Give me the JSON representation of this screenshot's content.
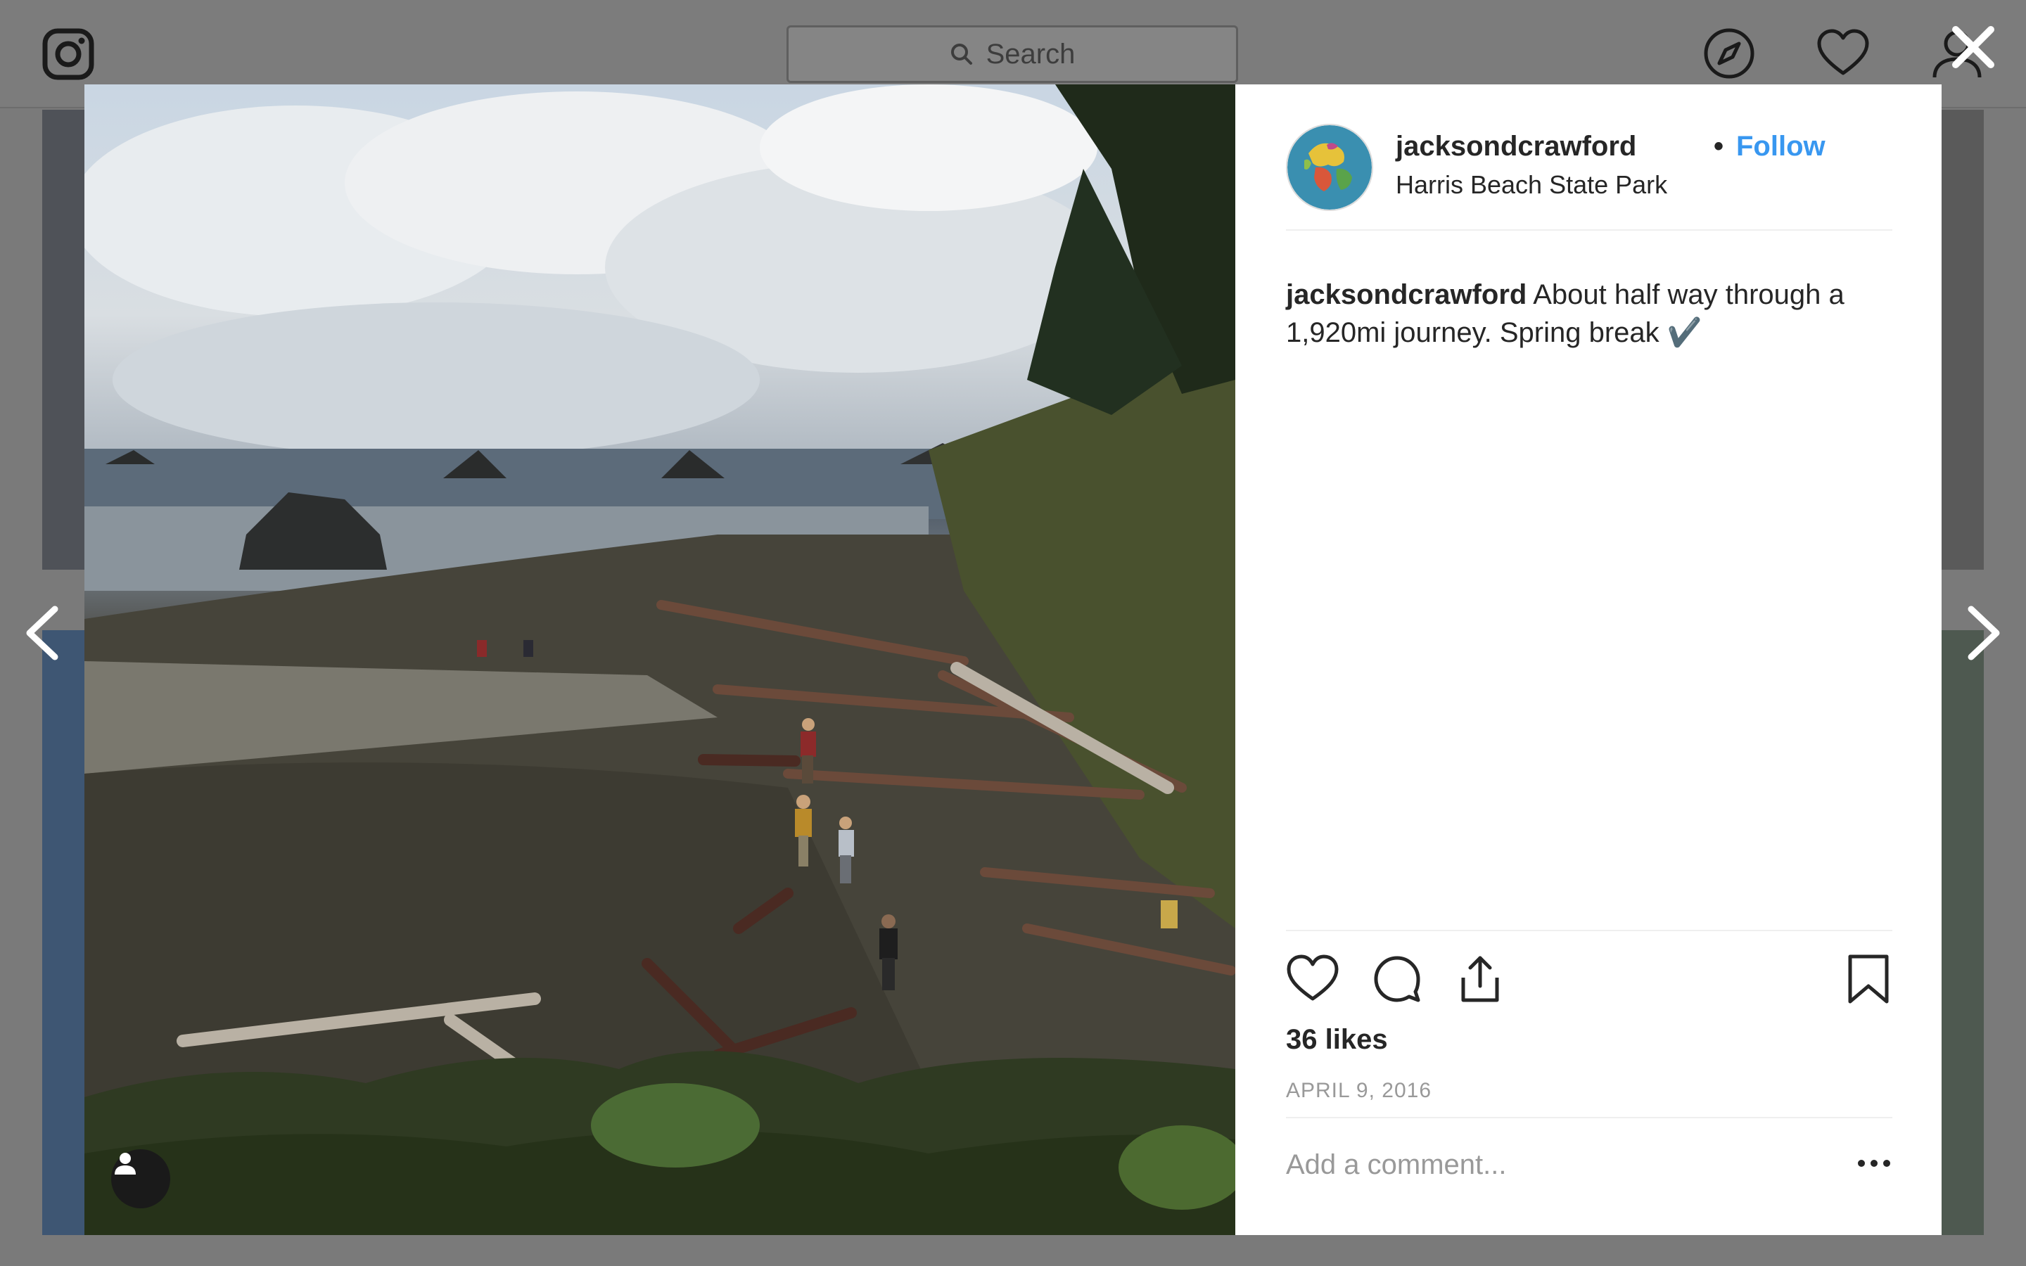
{
  "app": {
    "search_placeholder": "Search"
  },
  "post": {
    "username": "jacksondcrawford",
    "separator": "•",
    "follow_label": "Follow",
    "location": "Harris Beach State Park",
    "caption_user": "jacksondcrawford",
    "caption_text": "About half way through a 1,920mi journey. Spring break ✔️",
    "likes": "36 likes",
    "date": "APRIL 9, 2016",
    "comment_placeholder": "Add a comment..."
  },
  "colors": {
    "link": "#3897f0",
    "text": "#262626",
    "muted": "#999999",
    "overlay": "#7a7a7a"
  },
  "icons": {
    "logo": "instagram-icon",
    "search": "search-icon",
    "explore": "compass-icon",
    "activity": "heart-icon",
    "profile": "person-icon",
    "close": "close-icon",
    "prev": "chevron-left-icon",
    "next": "chevron-right-icon",
    "like": "heart-outline-icon",
    "comment": "comment-icon",
    "share": "share-icon",
    "save": "bookmark-icon",
    "more": "ellipsis-icon",
    "tag": "user-tag-icon"
  }
}
